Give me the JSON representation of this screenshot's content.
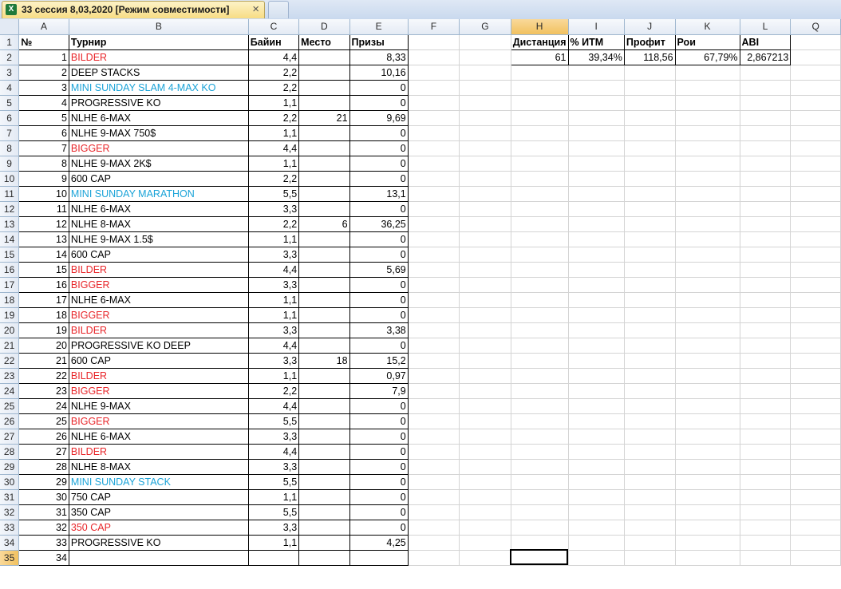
{
  "tab": {
    "title": "33 сессия 8,03,2020  [Режим совместимости]",
    "icon": "excel-icon",
    "close": "×"
  },
  "columns": [
    "A",
    "B",
    "C",
    "D",
    "E",
    "F",
    "G",
    "H",
    "I",
    "J",
    "K",
    "L",
    "Q"
  ],
  "selected_column": "H",
  "selected_row": 35,
  "colors": {
    "red": "#e8262a",
    "blue": "#1aa3d8"
  },
  "header_row": {
    "num": "№",
    "tournament": "Турнир",
    "buyin": "Байин",
    "place": "Место",
    "prize": "Призы"
  },
  "rows": [
    [
      "1",
      "BILDER",
      "4,4",
      "",
      "8,33",
      "red"
    ],
    [
      "2",
      "DEEP STACKS",
      "2,2",
      "",
      "10,16",
      ""
    ],
    [
      "3",
      "MINI SUNDAY SLAM 4-MAX KO",
      "2,2",
      "",
      "0",
      "blue"
    ],
    [
      "4",
      "PROGRESSIVE KO",
      "1,1",
      "",
      "0",
      ""
    ],
    [
      "5",
      "NLHE 6-MAX",
      "2,2",
      "21",
      "9,69",
      ""
    ],
    [
      "6",
      "NLHE 9-MAX 750$",
      "1,1",
      "",
      "0",
      ""
    ],
    [
      "7",
      "BIGGER",
      "4,4",
      "",
      "0",
      "red"
    ],
    [
      "8",
      "NLHE 9-MAX 2K$",
      "1,1",
      "",
      "0",
      ""
    ],
    [
      "9",
      "600 CAP",
      "2,2",
      "",
      "0",
      ""
    ],
    [
      "10",
      "MINI SUNDAY MARATHON",
      "5,5",
      "",
      "13,1",
      "blue"
    ],
    [
      "11",
      "NLHE 6-MAX",
      "3,3",
      "",
      "0",
      ""
    ],
    [
      "12",
      "NLHE 8-MAX",
      "2,2",
      "6",
      "36,25",
      ""
    ],
    [
      "13",
      "NLHE 9-MAX 1.5$",
      "1,1",
      "",
      "0",
      ""
    ],
    [
      "14",
      "600 CAP",
      "3,3",
      "",
      "0",
      ""
    ],
    [
      "15",
      "BILDER",
      "4,4",
      "",
      "5,69",
      "red"
    ],
    [
      "16",
      "BIGGER",
      "3,3",
      "",
      "0",
      "red"
    ],
    [
      "17",
      "NLHE 6-MAX",
      "1,1",
      "",
      "0",
      ""
    ],
    [
      "18",
      "BIGGER",
      "1,1",
      "",
      "0",
      "red"
    ],
    [
      "19",
      "BILDER",
      "3,3",
      "",
      "3,38",
      "red"
    ],
    [
      "20",
      "PROGRESSIVE KO DEEP",
      "4,4",
      "",
      "0",
      ""
    ],
    [
      "21",
      "600 CAP",
      "3,3",
      "18",
      "15,2",
      ""
    ],
    [
      "22",
      "BILDER",
      "1,1",
      "",
      "0,97",
      "red"
    ],
    [
      "23",
      "BIGGER",
      "2,2",
      "",
      "7,9",
      "red"
    ],
    [
      "24",
      "NLHE 9-MAX",
      "4,4",
      "",
      "0",
      ""
    ],
    [
      "25",
      "BIGGER",
      "5,5",
      "",
      "0",
      "red"
    ],
    [
      "26",
      "NLHE 6-MAX",
      "3,3",
      "",
      "0",
      ""
    ],
    [
      "27",
      "BILDER",
      "4,4",
      "",
      "0",
      "red"
    ],
    [
      "28",
      "NLHE 8-MAX",
      "3,3",
      "",
      "0",
      ""
    ],
    [
      "29",
      "MINI SUNDAY STACK",
      "5,5",
      "",
      "0",
      "blue"
    ],
    [
      "30",
      "750 CAP",
      "1,1",
      "",
      "0",
      ""
    ],
    [
      "31",
      "350 CAP",
      "5,5",
      "",
      "0",
      ""
    ],
    [
      "32",
      "350 CAP",
      "3,3",
      "",
      "0",
      "red"
    ],
    [
      "33",
      "PROGRESSIVE KO",
      "1,1",
      "",
      "4,25",
      ""
    ],
    [
      "34",
      "",
      "",
      "",
      "",
      ""
    ]
  ],
  "stats": {
    "labels": [
      "Дистанция",
      "% ИТМ",
      "Профит",
      "Рои",
      "ABI"
    ],
    "values": [
      "61",
      "39,34%",
      "118,56",
      "67,79%",
      "2,867213"
    ]
  }
}
